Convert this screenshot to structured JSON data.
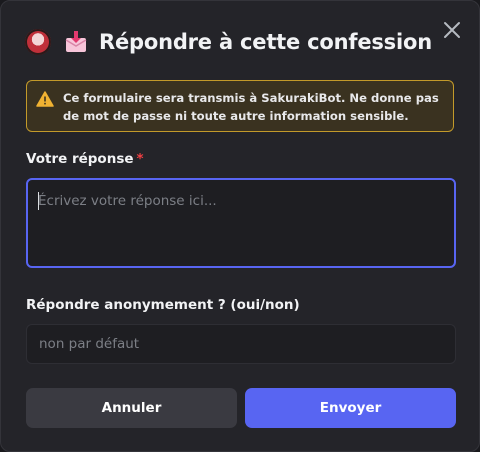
{
  "modal": {
    "title": "Répondre à cette confession",
    "bot_avatar_icon": "bot-avatar",
    "title_icon": "envelope-download-icon",
    "close_icon": "close-icon"
  },
  "warning": {
    "icon": "warning-icon",
    "text": "Ce formulaire sera transmis à SakurakiBot. Ne donne pas de mot de passe ni toute autre information sensible."
  },
  "fields": {
    "response": {
      "label": "Votre réponse",
      "required_mark": "*",
      "placeholder": "Écrivez votre réponse ici...",
      "value": ""
    },
    "anonymous": {
      "label": "Répondre anonymement ? (oui/non)",
      "placeholder": "non par défaut",
      "value": ""
    }
  },
  "buttons": {
    "cancel_label": "Annuler",
    "send_label": "Envoyer"
  },
  "colors": {
    "accent": "#5865f2",
    "warning_border": "#c39a2a",
    "warning_icon": "#f0b232",
    "required": "#f23f43"
  }
}
